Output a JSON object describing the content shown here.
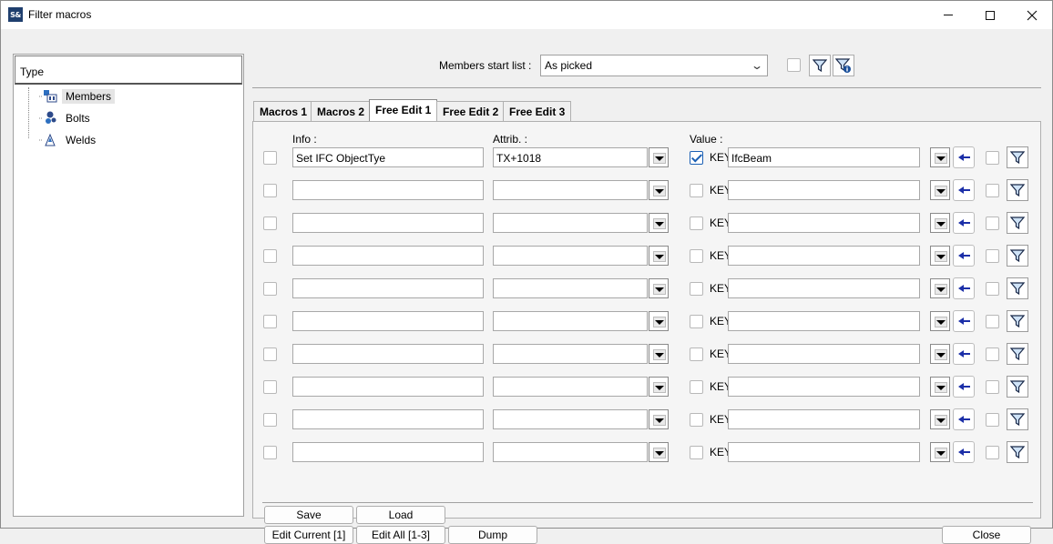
{
  "window": {
    "title": "Filter macros",
    "app_icon_text": "S&"
  },
  "tree": {
    "header": "Type",
    "items": [
      {
        "label": "Members",
        "icon": "members-icon",
        "selected": true
      },
      {
        "label": "Bolts",
        "icon": "bolts-icon",
        "selected": false
      },
      {
        "label": "Welds",
        "icon": "welds-icon",
        "selected": false
      }
    ]
  },
  "toolbar": {
    "start_list_label": "Members start list :",
    "start_list_value": "As picked"
  },
  "tabs": [
    {
      "label": "Macros 1",
      "active": false
    },
    {
      "label": "Macros 2",
      "active": false
    },
    {
      "label": "Free Edit 1",
      "active": true
    },
    {
      "label": "Free Edit 2",
      "active": false
    },
    {
      "label": "Free Edit 3",
      "active": false
    }
  ],
  "columns": {
    "info": "Info :",
    "attrib": "Attrib. :",
    "value": "Value :"
  },
  "key_label": "KEY",
  "rows": [
    {
      "enabled": false,
      "info": "Set IFC ObjectTye",
      "attrib": "TX+1018",
      "key": true,
      "value": "IfcBeam",
      "filter": false
    },
    {
      "enabled": false,
      "info": "",
      "attrib": "",
      "key": false,
      "value": "",
      "filter": false
    },
    {
      "enabled": false,
      "info": "",
      "attrib": "",
      "key": false,
      "value": "",
      "filter": false
    },
    {
      "enabled": false,
      "info": "",
      "attrib": "",
      "key": false,
      "value": "",
      "filter": false
    },
    {
      "enabled": false,
      "info": "",
      "attrib": "",
      "key": false,
      "value": "",
      "filter": false
    },
    {
      "enabled": false,
      "info": "",
      "attrib": "",
      "key": false,
      "value": "",
      "filter": false
    },
    {
      "enabled": false,
      "info": "",
      "attrib": "",
      "key": false,
      "value": "",
      "filter": false
    },
    {
      "enabled": false,
      "info": "",
      "attrib": "",
      "key": false,
      "value": "",
      "filter": false
    },
    {
      "enabled": false,
      "info": "",
      "attrib": "",
      "key": false,
      "value": "",
      "filter": false
    },
    {
      "enabled": false,
      "info": "",
      "attrib": "",
      "key": false,
      "value": "",
      "filter": false
    }
  ],
  "buttons": {
    "save": "Save",
    "load": "Load",
    "edit_current": "Edit Current [1]",
    "edit_all": "Edit All [1-3]",
    "dump": "Dump",
    "close": "Close"
  },
  "colors": {
    "accent": "#1a5fb4",
    "arrow": "#1c2fa8",
    "funnel_fill": "#cfe3f7"
  }
}
